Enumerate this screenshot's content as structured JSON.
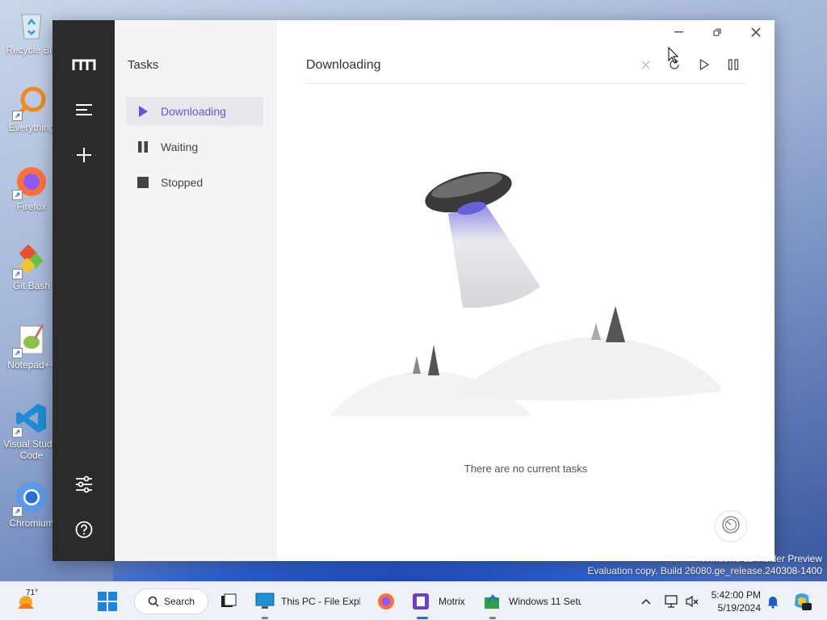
{
  "desktop": {
    "icons": [
      {
        "label": "Recycle Bin",
        "icon": "recycle-bin-icon"
      },
      {
        "label": "Everything",
        "icon": "everything-search-icon"
      },
      {
        "label": "Firefox",
        "icon": "firefox-icon"
      },
      {
        "label": "Git Bash",
        "icon": "git-bash-icon"
      },
      {
        "label": "Notepad++",
        "icon": "notepad-plus-plus-icon"
      },
      {
        "label": "Visual Studio Code",
        "icon": "vscode-icon"
      },
      {
        "label": "Chromium",
        "icon": "chromium-icon"
      }
    ],
    "watermark": {
      "line1": "Windows 11 Insider Preview",
      "line2": "Evaluation copy. Build 26080.ge_release.240308-1400"
    }
  },
  "app": {
    "name": "Motrix",
    "rail": {
      "logo": "motrix-logo-icon",
      "menu": "menu-icon",
      "add": "add-task-icon",
      "preferences": "preferences-sliders-icon",
      "help": "help-icon"
    },
    "tasks": {
      "title": "Tasks",
      "items": [
        {
          "label": "Downloading",
          "icon": "play-icon",
          "active": true
        },
        {
          "label": "Waiting",
          "icon": "pause-icon",
          "active": false
        },
        {
          "label": "Stopped",
          "icon": "stop-icon",
          "active": false
        }
      ]
    },
    "main": {
      "title": "Downloading",
      "toolbar": [
        "delete-icon",
        "refresh-icon",
        "resume-all-icon",
        "pause-all-icon"
      ],
      "empty_text": "There are no current tasks",
      "speed_button": "speedometer-icon"
    },
    "window_controls": [
      "minimize-icon",
      "maximize-icon",
      "close-icon"
    ],
    "accent": "#5b5bd6"
  },
  "taskbar": {
    "weather": {
      "temp": "71°"
    },
    "search_label": "Search",
    "apps": [
      {
        "label": "This PC - File Explo"
      },
      {
        "label": "Motrix"
      },
      {
        "label": "Windows 11 Setu"
      }
    ],
    "clock": {
      "time": "5:42:00 PM",
      "date": "5/19/2024"
    }
  }
}
